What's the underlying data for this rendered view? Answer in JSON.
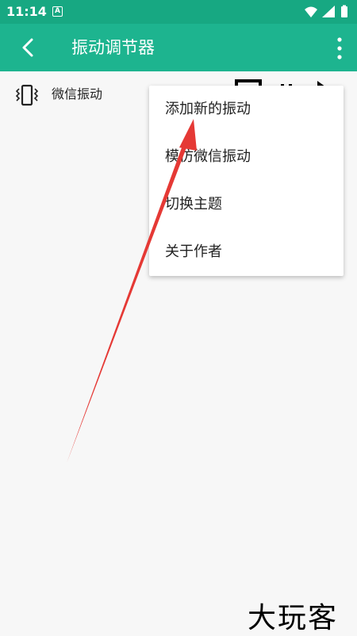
{
  "status": {
    "time": "11:14",
    "notif_badge": "A"
  },
  "appbar": {
    "title": "振动调节器"
  },
  "list": {
    "items": [
      {
        "label": "微信振动"
      }
    ]
  },
  "menu": {
    "items": [
      "添加新的振动",
      "模仿微信振动",
      "切换主题",
      "关于作者"
    ]
  },
  "watermark": "大玩客",
  "colors": {
    "statusbar": "#17a882",
    "appbar": "#1db48f",
    "arrow": "#e53935"
  },
  "icons": [
    "back-arrow-icon",
    "more-vert-icon",
    "vibration-icon",
    "wifi-icon",
    "signal-icon",
    "battery-icon"
  ]
}
